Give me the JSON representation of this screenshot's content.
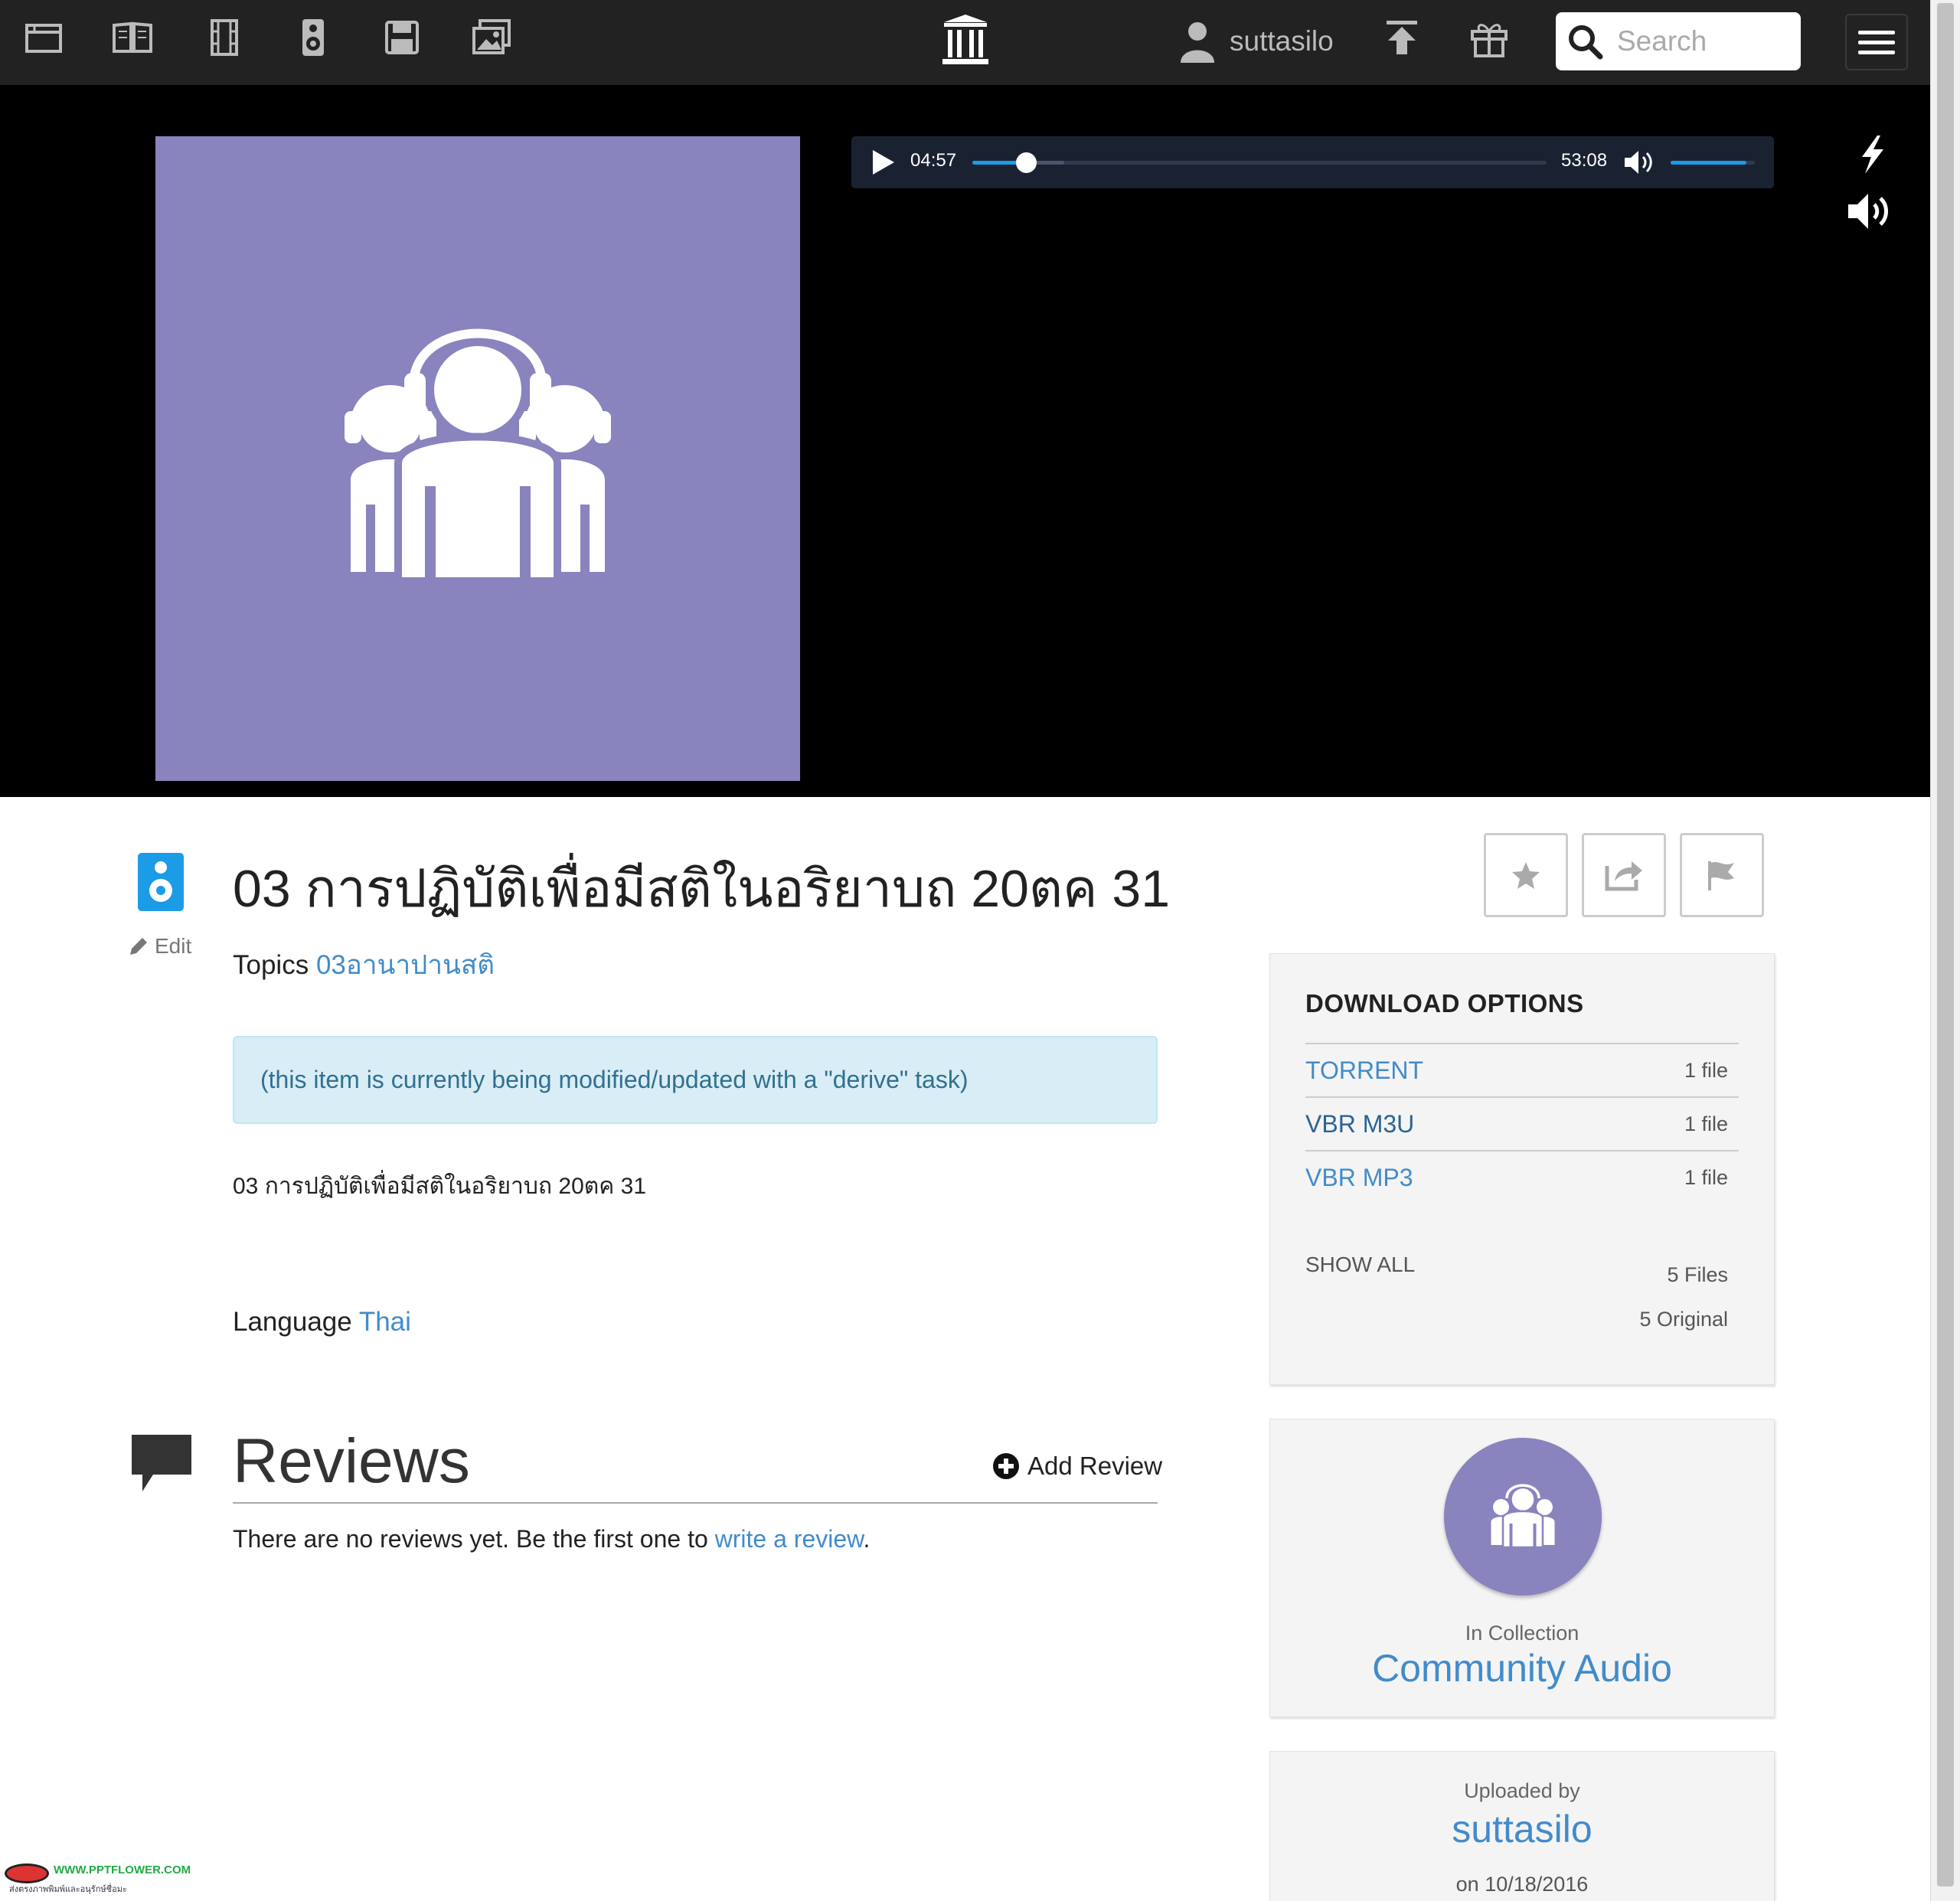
{
  "nav": {
    "icons": [
      "web-icon",
      "texts-icon",
      "video-icon",
      "audio-icon",
      "software-icon",
      "images-icon"
    ],
    "logo": "archive-logo-icon",
    "username": "suttasilo",
    "search_placeholder": "Search"
  },
  "player": {
    "current_time": "04:57",
    "total_time": "53:08",
    "progress_fraction": 0.093,
    "volume_fraction": 0.9
  },
  "item": {
    "title": "03 การปฏิบัติเพื่อมีสติในอริยาบถ 20ตค 31",
    "edit_label": "Edit",
    "topics_label": "Topics",
    "topics_value": "03อานาปานสติ",
    "notice": "(this item is currently being modified/updated with a \"derive\" task)",
    "description": "03 การปฏิบัติเพื่อมีสติในอริยาบถ 20ตค 31",
    "language_label": "Language",
    "language_value": "Thai"
  },
  "reviews": {
    "heading": "Reviews",
    "add_label": "Add Review",
    "empty_text_before": "There are no reviews yet. Be the first one to ",
    "empty_link": "write a review",
    "empty_text_after": "."
  },
  "downloads": {
    "title": "DOWNLOAD OPTIONS",
    "rows": [
      {
        "name": "TORRENT",
        "count": "1 file"
      },
      {
        "name": "VBR M3U",
        "count": "1 file"
      },
      {
        "name": "VBR MP3",
        "count": "1 file"
      }
    ],
    "show_all": "SHOW ALL",
    "files": "5 Files",
    "original": "5 Original"
  },
  "collection": {
    "label": "In Collection",
    "name": "Community Audio"
  },
  "uploader": {
    "label": "Uploaded by",
    "name": "suttasilo",
    "date": "on 10/18/2016"
  },
  "watermark": {
    "line1": "WWW.PPTFLOWER.COM",
    "line2": "ส่งตรงภาพพิมพ์และอนุรักษ์ชื่อมะ"
  },
  "colors": {
    "nav_bg": "#222222",
    "accent_blue": "#428bca",
    "audio_purple": "#8983be",
    "player_blue": "#1c9be6",
    "notice_bg": "#d9edf7",
    "notice_text": "#31708f"
  }
}
